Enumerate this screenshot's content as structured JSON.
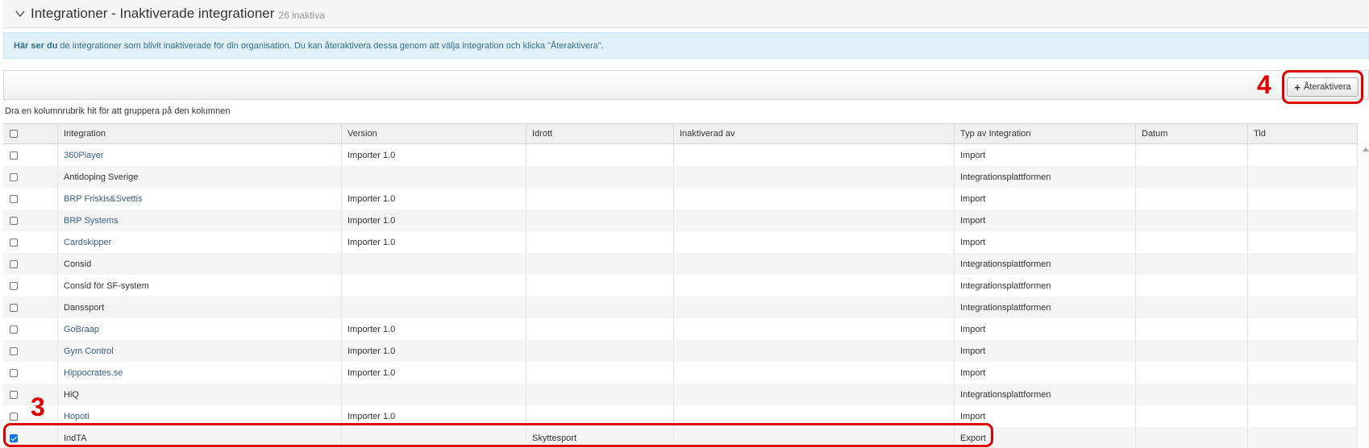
{
  "panel": {
    "title": "Integrationer - Inaktiverade integrationer",
    "count": "26 inaktiva"
  },
  "info": {
    "bold": "Här ser du",
    "text": "de integrationer som blivit inaktiverade för din organisation. Du kan återaktivera dessa genom att välja integration och klicka \"Återaktivera\"."
  },
  "toolbar": {
    "reactivate_label": "Återaktivera"
  },
  "grid": {
    "group_hint": "Dra en kolumnrubrik hit för att gruppera på den kolumnen",
    "columns": [
      "Integration",
      "Version",
      "Idrott",
      "Inaktiverad av",
      "Typ av Integration",
      "Datum",
      "Tid"
    ],
    "rows": [
      {
        "name": "360Player",
        "version": "Importer 1.0",
        "sport": "",
        "by": "",
        "type": "Import",
        "date": "",
        "time": "",
        "link": true,
        "checked": false
      },
      {
        "name": "Antidoping Sverige",
        "version": "",
        "sport": "",
        "by": "",
        "type": "Integrationsplattformen",
        "date": "",
        "time": "",
        "link": false,
        "checked": false
      },
      {
        "name": "BRP Friskis&Svettis",
        "version": "Importer 1.0",
        "sport": "",
        "by": "",
        "type": "Import",
        "date": "",
        "time": "",
        "link": true,
        "checked": false
      },
      {
        "name": "BRP Systems",
        "version": "Importer 1.0",
        "sport": "",
        "by": "",
        "type": "Import",
        "date": "",
        "time": "",
        "link": true,
        "checked": false
      },
      {
        "name": "Cardskipper",
        "version": "Importer 1.0",
        "sport": "",
        "by": "",
        "type": "Import",
        "date": "",
        "time": "",
        "link": true,
        "checked": false
      },
      {
        "name": "Consid",
        "version": "",
        "sport": "",
        "by": "",
        "type": "Integrationsplattformen",
        "date": "",
        "time": "",
        "link": false,
        "checked": false
      },
      {
        "name": "Consid för SF-system",
        "version": "",
        "sport": "",
        "by": "",
        "type": "Integrationsplattformen",
        "date": "",
        "time": "",
        "link": false,
        "checked": false
      },
      {
        "name": "Danssport",
        "version": "",
        "sport": "",
        "by": "",
        "type": "Integrationsplattformen",
        "date": "",
        "time": "",
        "link": false,
        "checked": false
      },
      {
        "name": "GoBraap",
        "version": "Importer 1.0",
        "sport": "",
        "by": "",
        "type": "Import",
        "date": "",
        "time": "",
        "link": true,
        "checked": false
      },
      {
        "name": "Gym Control",
        "version": "Importer 1.0",
        "sport": "",
        "by": "",
        "type": "Import",
        "date": "",
        "time": "",
        "link": true,
        "checked": false
      },
      {
        "name": "Hippocrates.se",
        "version": "Importer 1.0",
        "sport": "",
        "by": "",
        "type": "Import",
        "date": "",
        "time": "",
        "link": true,
        "checked": false
      },
      {
        "name": "HiQ",
        "version": "",
        "sport": "",
        "by": "",
        "type": "Integrationsplattformen",
        "date": "",
        "time": "",
        "link": false,
        "checked": false
      },
      {
        "name": "Hopoti",
        "version": "Importer 1.0",
        "sport": "",
        "by": "",
        "type": "Import",
        "date": "",
        "time": "",
        "link": true,
        "checked": false
      },
      {
        "name": "IndTA",
        "version": "",
        "sport": "Skyttesport",
        "by": "",
        "type": "Export",
        "date": "",
        "time": "",
        "link": false,
        "checked": true
      }
    ]
  },
  "annotations": {
    "step_reactivate": "4",
    "step_select": "3",
    "color": "#e00000"
  }
}
